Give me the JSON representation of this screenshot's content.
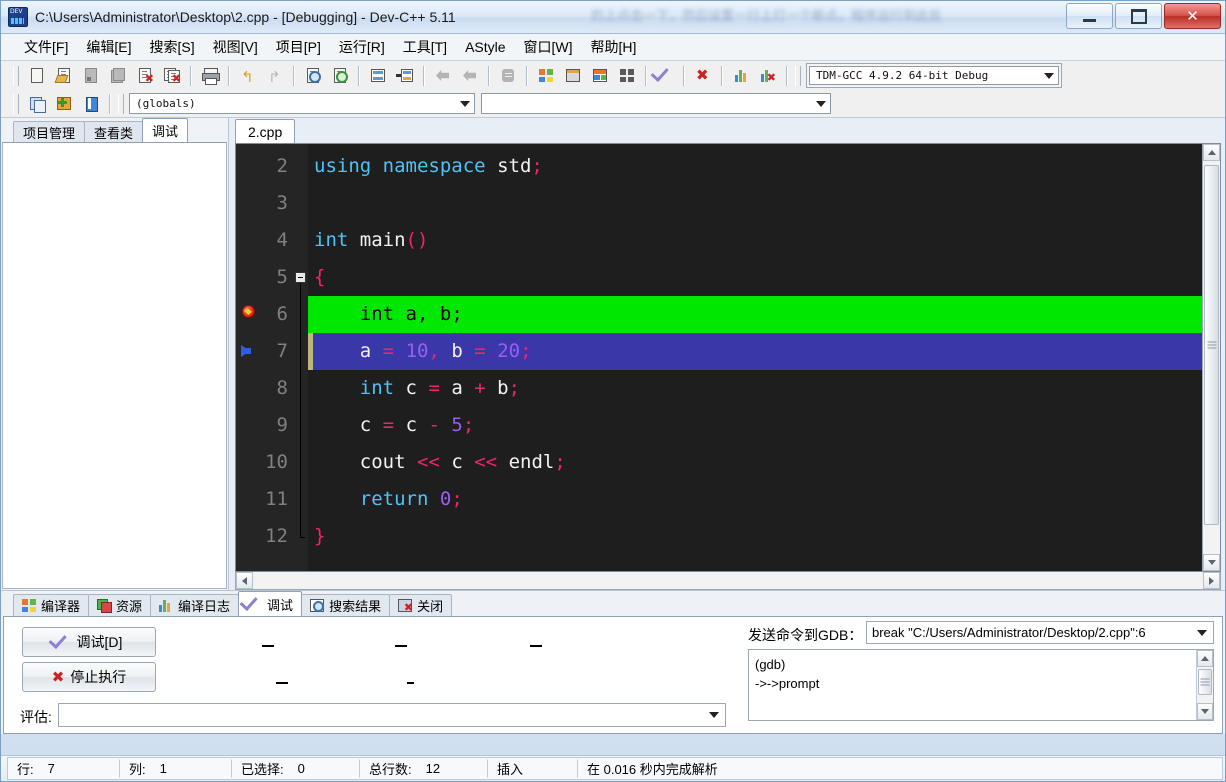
{
  "window": {
    "title": "C:\\Users\\Administrator\\Desktop\\2.cpp - [Debugging] - Dev-C++ 5.11",
    "watermark": "的上点击一下，然后设置一行上打一个断点，程序运行到此处",
    "minimize_label": "Minimize",
    "maximize_label": "Maximize",
    "close_label": "✕"
  },
  "menu": {
    "items": [
      {
        "label": "文件[F]"
      },
      {
        "label": "编辑[E]"
      },
      {
        "label": "搜索[S]"
      },
      {
        "label": "视图[V]"
      },
      {
        "label": "项目[P]"
      },
      {
        "label": "运行[R]"
      },
      {
        "label": "工具[T]"
      },
      {
        "label": "AStyle"
      },
      {
        "label": "窗口[W]"
      },
      {
        "label": "帮助[H]"
      }
    ]
  },
  "toolbar": {
    "compiler_set": "TDM-GCC 4.9.2 64-bit Debug",
    "scope_combo": "(globals)",
    "class_combo": "",
    "icons_row1": [
      "new-file-icon",
      "open-file-icon",
      "save-icon",
      "save-all-icon",
      "close-file-icon",
      "close-all-icon",
      "print-icon",
      "undo-icon",
      "redo-icon",
      "find-icon",
      "replace-icon",
      "goto-line-icon",
      "goto-function-icon",
      "back-icon",
      "forward-icon",
      "toggle-icon",
      "compile-icon",
      "run-icon",
      "compile-run-icon",
      "rebuild-icon",
      "debug-icon",
      "stop-icon",
      "profile-icon",
      "delete-profile-icon"
    ],
    "icons_row2": [
      "new-project-icon",
      "add-to-project-icon",
      "remove-from-project-icon"
    ]
  },
  "left_panel": {
    "tabs": [
      {
        "label": "项目管理",
        "active": false
      },
      {
        "label": "查看类",
        "active": false
      },
      {
        "label": "调试",
        "active": true
      }
    ]
  },
  "editor": {
    "tab_label": "2.cpp",
    "first_visible_line": 2,
    "lines": [
      {
        "number": "2",
        "state": "normal",
        "marker": "none",
        "tokens": [
          {
            "t": "using",
            "c": "kw"
          },
          {
            "t": " ",
            "c": "id"
          },
          {
            "t": "namespace",
            "c": "kw"
          },
          {
            "t": " ",
            "c": "id"
          },
          {
            "t": "std",
            "c": "id"
          },
          {
            "t": ";",
            "c": "punc"
          }
        ]
      },
      {
        "number": "3",
        "state": "normal",
        "marker": "none",
        "tokens": []
      },
      {
        "number": "4",
        "state": "normal",
        "marker": "none",
        "tokens": [
          {
            "t": "int",
            "c": "kw"
          },
          {
            "t": " ",
            "c": "id"
          },
          {
            "t": "main",
            "c": "id"
          },
          {
            "t": "()",
            "c": "punc"
          }
        ]
      },
      {
        "number": "5",
        "state": "normal",
        "marker": "fold",
        "tokens": [
          {
            "t": "{",
            "c": "punc"
          }
        ]
      },
      {
        "number": "6",
        "state": "breakpoint",
        "marker": "breakpoint",
        "tokens": [
          {
            "t": "    ",
            "c": "id"
          },
          {
            "t": "int",
            "c": "kw"
          },
          {
            "t": " ",
            "c": "id"
          },
          {
            "t": "a",
            "c": "id"
          },
          {
            "t": ",",
            "c": "punc"
          },
          {
            "t": " ",
            "c": "id"
          },
          {
            "t": "b",
            "c": "id"
          },
          {
            "t": ";",
            "c": "punc"
          }
        ]
      },
      {
        "number": "7",
        "state": "current",
        "marker": "execution-arrow",
        "tokens": [
          {
            "t": "    ",
            "c": "id"
          },
          {
            "t": "a",
            "c": "id"
          },
          {
            "t": " ",
            "c": "id"
          },
          {
            "t": "=",
            "c": "op"
          },
          {
            "t": " ",
            "c": "id"
          },
          {
            "t": "10",
            "c": "num"
          },
          {
            "t": ",",
            "c": "punc"
          },
          {
            "t": " ",
            "c": "id"
          },
          {
            "t": "b",
            "c": "id"
          },
          {
            "t": " ",
            "c": "id"
          },
          {
            "t": "=",
            "c": "op"
          },
          {
            "t": " ",
            "c": "id"
          },
          {
            "t": "20",
            "c": "num"
          },
          {
            "t": ";",
            "c": "punc"
          }
        ]
      },
      {
        "number": "8",
        "state": "normal",
        "marker": "none",
        "tokens": [
          {
            "t": "    ",
            "c": "id"
          },
          {
            "t": "int",
            "c": "kw"
          },
          {
            "t": " ",
            "c": "id"
          },
          {
            "t": "c",
            "c": "id"
          },
          {
            "t": " ",
            "c": "id"
          },
          {
            "t": "=",
            "c": "op"
          },
          {
            "t": " ",
            "c": "id"
          },
          {
            "t": "a",
            "c": "id"
          },
          {
            "t": " ",
            "c": "id"
          },
          {
            "t": "+",
            "c": "op"
          },
          {
            "t": " ",
            "c": "id"
          },
          {
            "t": "b",
            "c": "id"
          },
          {
            "t": ";",
            "c": "punc"
          }
        ]
      },
      {
        "number": "9",
        "state": "normal",
        "marker": "none",
        "tokens": [
          {
            "t": "    ",
            "c": "id"
          },
          {
            "t": "c",
            "c": "id"
          },
          {
            "t": " ",
            "c": "id"
          },
          {
            "t": "=",
            "c": "op"
          },
          {
            "t": " ",
            "c": "id"
          },
          {
            "t": "c",
            "c": "id"
          },
          {
            "t": " ",
            "c": "id"
          },
          {
            "t": "-",
            "c": "op"
          },
          {
            "t": " ",
            "c": "id"
          },
          {
            "t": "5",
            "c": "num"
          },
          {
            "t": ";",
            "c": "punc"
          }
        ]
      },
      {
        "number": "10",
        "state": "normal",
        "marker": "none",
        "tokens": [
          {
            "t": "    ",
            "c": "id"
          },
          {
            "t": "cout",
            "c": "id"
          },
          {
            "t": " ",
            "c": "id"
          },
          {
            "t": "<<",
            "c": "op"
          },
          {
            "t": " ",
            "c": "id"
          },
          {
            "t": "c",
            "c": "id"
          },
          {
            "t": " ",
            "c": "id"
          },
          {
            "t": "<<",
            "c": "op"
          },
          {
            "t": " ",
            "c": "id"
          },
          {
            "t": "endl",
            "c": "id"
          },
          {
            "t": ";",
            "c": "punc"
          }
        ]
      },
      {
        "number": "11",
        "state": "normal",
        "marker": "none",
        "tokens": [
          {
            "t": "    ",
            "c": "id"
          },
          {
            "t": "return",
            "c": "kw"
          },
          {
            "t": " ",
            "c": "id"
          },
          {
            "t": "0",
            "c": "num"
          },
          {
            "t": ";",
            "c": "punc"
          }
        ]
      },
      {
        "number": "12",
        "state": "normal",
        "marker": "fold-end",
        "tokens": [
          {
            "t": "}",
            "c": "punc"
          }
        ]
      }
    ],
    "colors": {
      "background": "#1e1e1e",
      "keyword": "#4fc3f7",
      "number": "#9b5cf6",
      "operator": "#f0246e",
      "identifier": "#f2f2f2",
      "breakpoint_line_bg": "#00e800",
      "current_line_bg": "#3a37a8",
      "current_line_stripe": "#bfb77a",
      "gutter_text": "#808080"
    }
  },
  "bottom": {
    "tabs": [
      {
        "label": "编译器",
        "icon": "compiler-icon",
        "active": false
      },
      {
        "label": "资源",
        "icon": "resource-icon",
        "active": false
      },
      {
        "label": "编译日志",
        "icon": "log-icon",
        "active": false
      },
      {
        "label": "调试",
        "icon": "debug-check-icon",
        "active": true
      },
      {
        "label": "搜索结果",
        "icon": "search-result-icon",
        "active": false
      },
      {
        "label": "关闭",
        "icon": "close-icon",
        "active": false
      }
    ],
    "debug_button": "调试[D]",
    "stop_button": "停止执行",
    "eval_label": "评估:",
    "eval_value": "",
    "gdb_label": "发送命令到GDB：",
    "gdb_command": "break \"C:/Users/Administrator/Desktop/2.cpp\":6",
    "gdb_output": "(gdb)\n->->prompt"
  },
  "statusbar": {
    "row_label": "行:",
    "row_value": "7",
    "col_label": "列:",
    "col_value": "1",
    "sel_label": "已选择:",
    "sel_value": "0",
    "total_label": "总行数:",
    "total_value": "12",
    "mode": "插入",
    "parse_info": "在 0.016 秒内完成解析"
  }
}
